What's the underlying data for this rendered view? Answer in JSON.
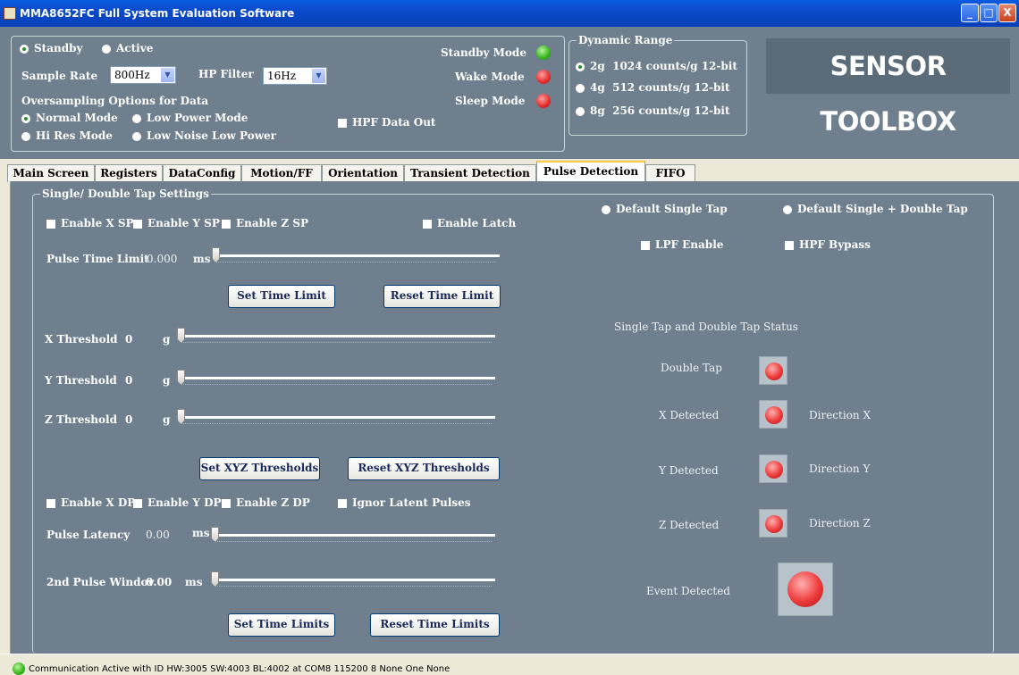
{
  "window": {
    "title": "MMA8652FC Full System Evaluation Software",
    "min": "_",
    "max": "□",
    "close": "X"
  },
  "top": {
    "standby_label": "Standby",
    "active_label": "Active",
    "sample_rate_label": "Sample Rate",
    "sample_rate_value": "800Hz",
    "hp_filter_label": "HP Filter",
    "hp_filter_value": "16Hz",
    "oversampling_label": "Oversampling Options for Data",
    "normal_mode": "Normal Mode",
    "low_power_mode": "Low Power Mode",
    "hi_res_mode": "Hi Res Mode",
    "low_noise_low_power": "Low Noise Low Power",
    "hpf_data_out": "HPF Data Out",
    "standby_mode": "Standby Mode",
    "wake_mode": "Wake Mode",
    "sleep_mode": "Sleep Mode"
  },
  "dynamic_range": {
    "title": "Dynamic Range",
    "options": [
      {
        "g": "2g",
        "desc": "1024 counts/g 12-bit"
      },
      {
        "g": "4g",
        "desc": "512 counts/g 12-bit"
      },
      {
        "g": "8g",
        "desc": "256 counts/g 12-bit"
      }
    ]
  },
  "brand": "SENSOR TOOLBOX",
  "tabs": [
    "Main Screen",
    "Registers",
    "DataConfig",
    "Motion/FF",
    "Orientation",
    "Transient Detection",
    "Pulse Detection",
    "FIFO"
  ],
  "pulse": {
    "group_title": "Single/ Double Tap Settings",
    "enable_x_sp": "Enable X SP",
    "enable_y_sp": "Enable Y SP",
    "enable_z_sp": "Enable Z SP",
    "enable_latch": "Enable Latch",
    "pulse_time_limit_label": "Pulse Time Limit",
    "pulse_time_limit_value": "0.000",
    "ms": "ms",
    "set_time_limit": "Set Time Limit",
    "reset_time_limit": "Reset Time Limit",
    "x_threshold_label": "X Threshold",
    "y_threshold_label": "Y Threshold",
    "z_threshold_label": "Z Threshold",
    "threshold_value": "0",
    "g": "g",
    "set_xyz": "Set XYZ Thresholds",
    "reset_xyz": "Reset XYZ Thresholds",
    "enable_x_dp": "Enable X DP",
    "enable_y_dp": "Enable Y DP",
    "enable_z_dp": "Enable Z DP",
    "ignor_latent": "Ignor Latent Pulses",
    "pulse_latency_label": "Pulse Latency",
    "pulse_latency_value": "0.00",
    "second_pulse_label": "2nd Pulse Windov",
    "second_pulse_value": "0.00",
    "set_time_limits": "Set Time Limits",
    "reset_time_limits": "Reset Time Limits",
    "default_single_tap": "Default Single Tap",
    "default_single_double": "Default Single + Double Tap",
    "lpf_enable": "LPF Enable",
    "hpf_bypass": "HPF Bypass",
    "status_title": "Single Tap and Double Tap Status",
    "double_tap": "Double Tap",
    "x_detected": "X Detected",
    "y_detected": "Y Detected",
    "z_detected": "Z Detected",
    "dir_x": "Direction X",
    "dir_y": "Direction Y",
    "dir_z": "Direction Z",
    "event_detected": "Event Detected"
  },
  "status": "Communication Active with ID HW:3005 SW:4003 BL:4002 at COM8 115200 8 None One None"
}
